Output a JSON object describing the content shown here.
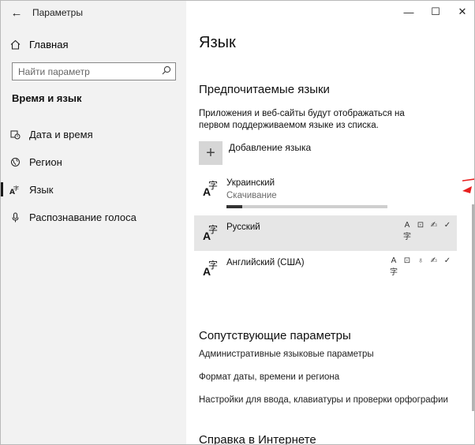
{
  "window": {
    "app_title": "Параметры",
    "back_icon": "arrow-left-icon",
    "controls": {
      "minimize": "—",
      "maximize": "☐",
      "close": "✕"
    }
  },
  "sidebar": {
    "home": {
      "label": "Главная",
      "icon": "home-icon"
    },
    "search": {
      "placeholder": "Найти параметр",
      "icon": "search-icon"
    },
    "section_title": "Время и язык",
    "items": [
      {
        "label": "Дата и время",
        "icon": "calendar-clock-icon",
        "active": false
      },
      {
        "label": "Регион",
        "icon": "globe-icon",
        "active": false
      },
      {
        "label": "Язык",
        "icon": "language-icon",
        "active": true
      },
      {
        "label": "Распознавание голоса",
        "icon": "microphone-icon",
        "active": false
      }
    ]
  },
  "main": {
    "page_title": "Язык",
    "preferred_title": "Предпочитаемые языки",
    "preferred_description": "Приложения и веб-сайты будут отображаться на первом поддерживаемом языке из списка.",
    "add_language_label": "Добавление языка",
    "languages": [
      {
        "name": "Украинский",
        "status": "Скачивание",
        "progress": 0.1,
        "selected": false,
        "features": []
      },
      {
        "name": "Русский",
        "status": "",
        "selected": true,
        "features": [
          "display-language-icon",
          "speech-icon",
          "handwriting-icon",
          "spellcheck-icon"
        ]
      },
      {
        "name": "Английский (США)",
        "status": "",
        "selected": false,
        "features": [
          "display-language-icon",
          "speech-icon",
          "microphone-icon",
          "handwriting-icon",
          "spellcheck-icon"
        ]
      }
    ],
    "related_title": "Сопутствующие параметры",
    "related_links": [
      "Административные языковые параметры",
      "Формат даты, времени и региона",
      "Настройки для ввода, клавиатуры и проверки орфографии"
    ],
    "help_title": "Справка в Интернете"
  },
  "colors": {
    "sidebar_bg": "#f2f2f2",
    "selected_row": "#e6e6e6",
    "annotation_arrow": "#e8201f"
  }
}
